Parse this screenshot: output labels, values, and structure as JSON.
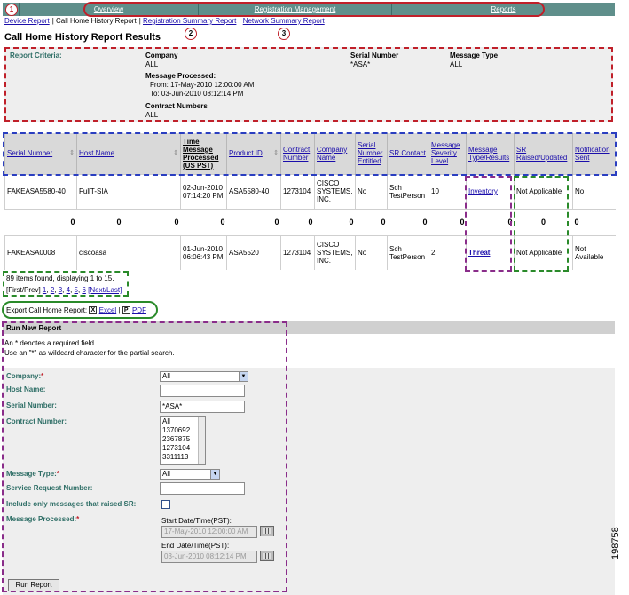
{
  "nav": {
    "tabs": [
      "Overview",
      "Registration Management",
      "Reports"
    ],
    "subnav": [
      "Device Report",
      "Call Home History Report",
      "Registration Summary Report",
      "Network Summary Report"
    ],
    "callouts": [
      "1",
      "2",
      "3"
    ]
  },
  "page": {
    "title": "Call Home History Report Results"
  },
  "criteria": {
    "label": "Report Criteria:",
    "company_label": "Company",
    "company_value": "ALL",
    "serial_label": "Serial Number",
    "serial_value": "*ASA*",
    "msgtype_label": "Message Type",
    "msgtype_value": "ALL",
    "processed_label": "Message Processed:",
    "from": "From: 17-May-2010 12:00:00 AM",
    "to": "To: 03-Jun-2010 08:12:14 PM",
    "contract_label": "Contract Numbers",
    "contract_value": "ALL"
  },
  "table": {
    "headers": [
      "Serial Number",
      "Host Name",
      "Time Message Processed (US PST)",
      "Product ID",
      "Contract Number",
      "Company Name",
      "Serial Number Entitled",
      "SR Contact",
      "Message Severity Level",
      "Message Type/Results",
      "SR Raised/Updated",
      "Notification Sent"
    ],
    "row1": [
      "FAKEASA5580-40",
      "FullT-SIA",
      "02-Jun-2010 07:14:20 PM",
      "ASA5580-40",
      "1273104",
      "CISCO SYSTEMS, INC.",
      "No",
      "Sch TestPerson",
      "10",
      "Inventory",
      "Not Applicable",
      "No"
    ],
    "zero": "0",
    "row2": [
      "FAKEASA0008",
      "ciscoasa",
      "01-Jun-2010 06:06:43 PM",
      "ASA5520",
      "1273104",
      "CISCO SYSTEMS, INC.",
      "No",
      "Sch TestPerson",
      "2",
      "Threat",
      "Not Applicable",
      "Not Available"
    ]
  },
  "paging": {
    "found": "89 items found, displaying 1 to 15.",
    "first_prev": "[First/Prev]",
    "pages": [
      "1",
      "2",
      "3",
      "4",
      "5",
      "6"
    ],
    "next_last": "[Next/Last]"
  },
  "export": {
    "label": "Export Call Home Report:",
    "excel": "Excel",
    "pdf": "PDF",
    "sep": "|"
  },
  "run_report": {
    "heading": "Run New Report",
    "note1": "An * denotes a required field.",
    "note2": "Use an \"*\" as wildcard character for the partial search.",
    "company_label": "Company:",
    "company_value": "All",
    "host_label": "Host Name:",
    "host_value": "",
    "serial_label": "Serial Number:",
    "serial_value": "*ASA*",
    "contract_label": "Contract Number:",
    "contract_options": [
      "All",
      "1370692",
      "2367875",
      "1273104",
      "3311113"
    ],
    "msgtype_label": "Message Type:",
    "msgtype_value": "All",
    "sr_label": "Service Request Number:",
    "include_label": "Include only messages that raised SR:",
    "processed_label": "Message Processed:",
    "start_label": "Start Date/Time(PST):",
    "start_value": "17-May-2010 12:00:00 AM",
    "end_label": "End Date/Time(PST):",
    "end_value": "03-Jun-2010 08:12:14 PM",
    "button": "Run Report"
  },
  "figure_id": "198758"
}
